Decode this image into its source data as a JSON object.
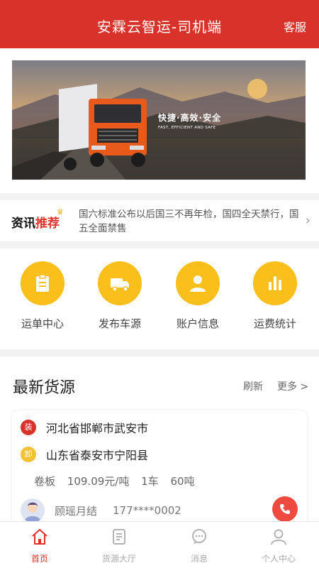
{
  "header": {
    "title": "安霖云智运-司机端",
    "service_label": "客服"
  },
  "banner": {
    "slogan": "快捷·高效·安全",
    "slogan_en": "FAST, EFFICIENT AND SAFE"
  },
  "news": {
    "tag_main": "资讯",
    "tag_accent": "推荐",
    "text": "国六标准公布以后国三不再年检，国四全天禁行，国五全面禁售"
  },
  "quick_actions": [
    {
      "label": "运单中心",
      "icon": "clipboard-icon"
    },
    {
      "label": "发布车源",
      "icon": "truck-icon"
    },
    {
      "label": "账户信息",
      "icon": "user-icon"
    },
    {
      "label": "运费统计",
      "icon": "bar-chart-icon"
    }
  ],
  "latest": {
    "title": "最新货源",
    "refresh_label": "刷新",
    "more_label": "更多 >"
  },
  "cargo_card": {
    "load_badge": "装",
    "load_city": "河北省邯郸市武安市",
    "unload_badge": "卸",
    "unload_city": "山东省泰安市宁阳县",
    "goods": "卷板",
    "price": "109.09元/吨",
    "trucks": "1车",
    "weight": "60吨",
    "contact_name": "顾瑶月结",
    "contact_phone": "177****0002"
  },
  "tabs": [
    {
      "label": "首页",
      "icon": "home-icon"
    },
    {
      "label": "货源大厅",
      "icon": "list-icon"
    },
    {
      "label": "消息",
      "icon": "message-icon"
    },
    {
      "label": "个人中心",
      "icon": "person-icon"
    }
  ],
  "colors": {
    "brand_red": "#d9322b",
    "accent_yellow": "#fbbf1b",
    "load_badge": "#d9322b",
    "unload_badge": "#f1c232",
    "call_button": "#ef4a3f"
  }
}
